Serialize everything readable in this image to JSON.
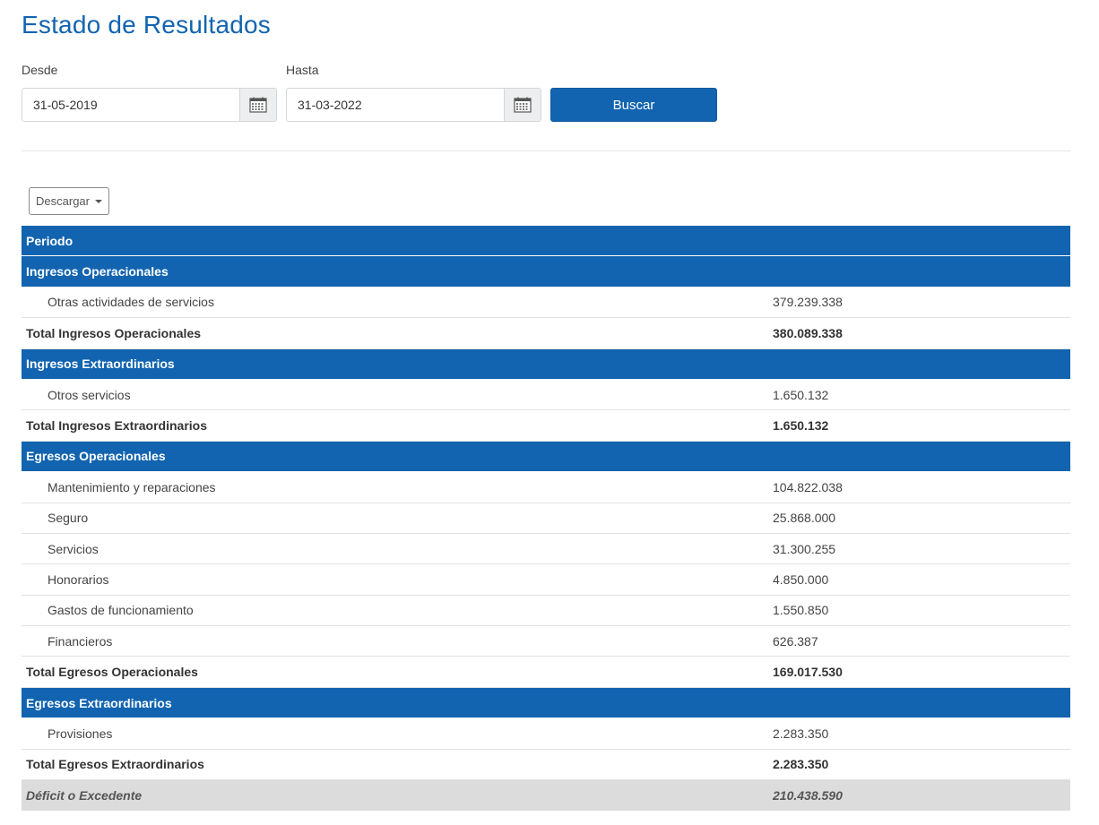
{
  "title": "Estado de Resultados",
  "filters": {
    "desde_label": "Desde",
    "desde_value": "31-05-2019",
    "hasta_label": "Hasta",
    "hasta_value": "31-03-2022",
    "buscar_label": "Buscar",
    "calendar_icon": "calendar-icon"
  },
  "descargar_label": "Descargar",
  "table": {
    "periodo_label": "Periodo",
    "sections": [
      {
        "title": "Ingresos Operacionales",
        "items": [
          {
            "name": "Otras actividades de servicios",
            "value": "379.239.338"
          }
        ],
        "total_label": "Total Ingresos Operacionales",
        "total_value": "380.089.338"
      },
      {
        "title": "Ingresos Extraordinarios",
        "items": [
          {
            "name": "Otros servicios",
            "value": "1.650.132"
          }
        ],
        "total_label": "Total Ingresos Extraordinarios",
        "total_value": "1.650.132"
      },
      {
        "title": "Egresos Operacionales",
        "items": [
          {
            "name": "Mantenimiento y reparaciones",
            "value": "104.822.038"
          },
          {
            "name": "Seguro",
            "value": "25.868.000"
          },
          {
            "name": "Servicios",
            "value": "31.300.255"
          },
          {
            "name": "Honorarios",
            "value": "4.850.000"
          },
          {
            "name": "Gastos de funcionamiento",
            "value": "1.550.850"
          },
          {
            "name": "Financieros",
            "value": "626.387"
          }
        ],
        "total_label": "Total Egresos Operacionales",
        "total_value": "169.017.530"
      },
      {
        "title": "Egresos Extraordinarios",
        "items": [
          {
            "name": "Provisiones",
            "value": "2.283.350"
          }
        ],
        "total_label": "Total Egresos Extraordinarios",
        "total_value": "2.283.350"
      }
    ],
    "result_label": "Déficit o Excedente",
    "result_value": "210.438.590"
  },
  "colors": {
    "primary": "#1264b0",
    "result_bg": "#dcdcdc"
  }
}
